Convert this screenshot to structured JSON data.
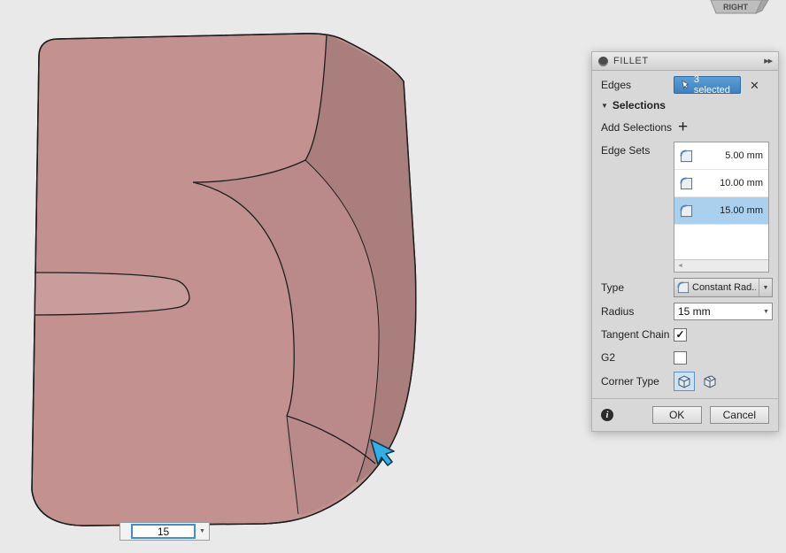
{
  "colors": {
    "model_front": "#c29190",
    "model_fillet_band": "#b98a89",
    "model_side": "#aa7e7d",
    "model_band_highlight": "#c99d9b",
    "accent_blue": "#3f80c0",
    "selection_blue": "#a9d0ee",
    "cursor_blue": "#2fb1e6"
  },
  "viewcube": {
    "label": "RIGHT"
  },
  "canvas": {
    "radius_input_value": "15"
  },
  "icons": {
    "collapse": "▶▶",
    "close": "✕",
    "add": "+",
    "section_triangle": "▼",
    "dropdown_arrow": "▼",
    "scroll_left": "◄",
    "info": "i",
    "check": "✓"
  },
  "dialog": {
    "title": "FILLET",
    "edges": {
      "label": "Edges",
      "selected_badge": "3 selected"
    },
    "selections": {
      "header": "Selections",
      "add_label": "Add Selections",
      "edge_sets_label": "Edge Sets",
      "edge_sets": [
        {
          "value": "5.00 mm",
          "selected": false
        },
        {
          "value": "10.00 mm",
          "selected": false
        },
        {
          "value": "15.00 mm",
          "selected": true
        }
      ]
    },
    "type": {
      "label": "Type",
      "value": "Constant Rad..."
    },
    "radius": {
      "label": "Radius",
      "value": "15 mm"
    },
    "tangent_chain": {
      "label": "Tangent Chain",
      "checked": true
    },
    "g2": {
      "label": "G2",
      "checked": false
    },
    "corner_type": {
      "label": "Corner Type"
    },
    "footer": {
      "ok_label": "OK",
      "cancel_label": "Cancel"
    }
  }
}
